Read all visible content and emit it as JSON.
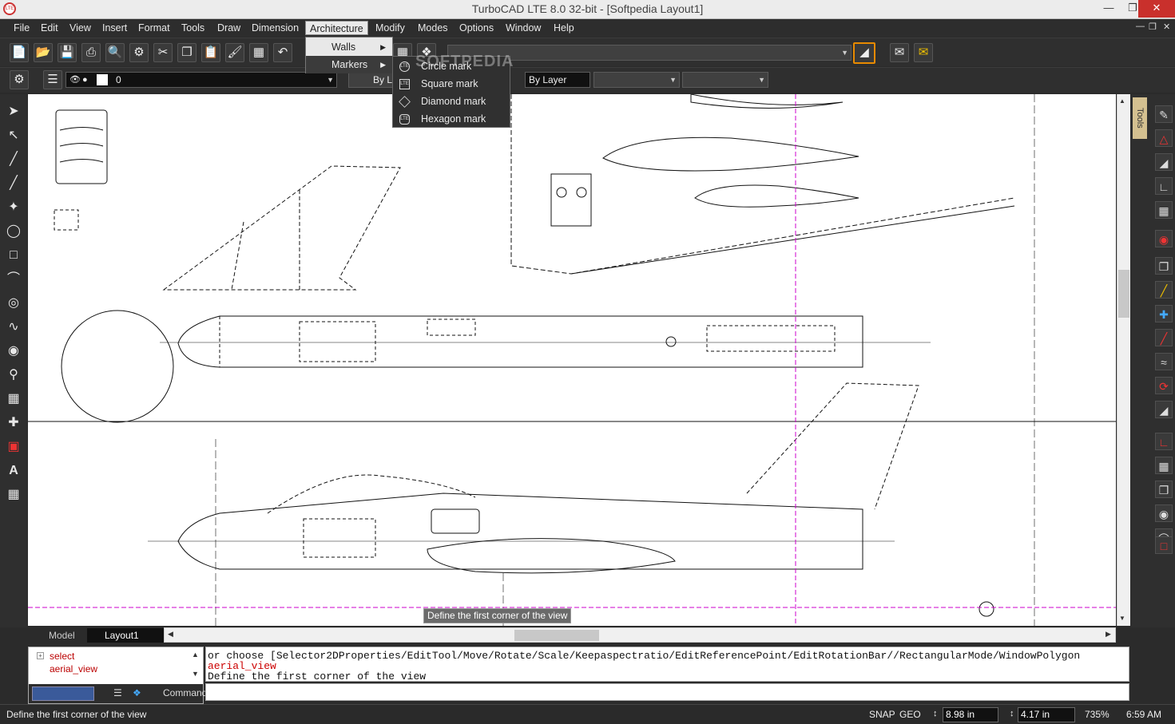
{
  "window": {
    "title": "TurboCAD LTE 8.0 32-bit - [Softpedia Layout1]",
    "logo_text": "LTE"
  },
  "menu": {
    "items": [
      "File",
      "Edit",
      "View",
      "Insert",
      "Format",
      "Tools",
      "Draw",
      "Dimension",
      "Architecture",
      "Modify",
      "Modes",
      "Options",
      "Window",
      "Help"
    ],
    "active": "Architecture"
  },
  "architecture_menu": {
    "walls": "Walls",
    "markers": "Markers"
  },
  "markers_submenu": [
    {
      "label": "Circle mark",
      "icon": "circle-mark-icon"
    },
    {
      "label": "Square mark",
      "icon": "square-mark-icon"
    },
    {
      "label": "Diamond mark",
      "icon": "diamond-mark-icon"
    },
    {
      "label": "Hexagon mark",
      "icon": "hexagon-mark-icon"
    }
  ],
  "props_toolbar": {
    "layer_value": "0",
    "color_value": "By Layer",
    "linestyle_value": "By L"
  },
  "watermark": "SOFTPEDIA",
  "sheet_tabs": {
    "model": "Model",
    "layout": "Layout1"
  },
  "history": {
    "items": [
      "select",
      "aerial_view"
    ]
  },
  "command_output": {
    "line1": " or choose [Selector2DProperties/EditTool/Move/Rotate/Scale/Keepaspectratio/EditReferencePoint/EditRotationBar//RectangularMode/WindowPolygon",
    "line2": "aerial_view",
    "line3": "Define the first corner of the view"
  },
  "command_label": "Command:",
  "tooltip": "Define the first corner of the view",
  "status": {
    "prompt": "Define the first corner of the view",
    "snap": "SNAP",
    "geo": "GEO",
    "x": "8.98 in",
    "y": "4.17 in",
    "zoom": "735%",
    "time": "6:59 AM"
  },
  "tools_tab": "Tools",
  "colors": {
    "accent_orange": "#e88a00",
    "guide_magenta": "#cc00cc",
    "close_red": "#c9302c"
  }
}
